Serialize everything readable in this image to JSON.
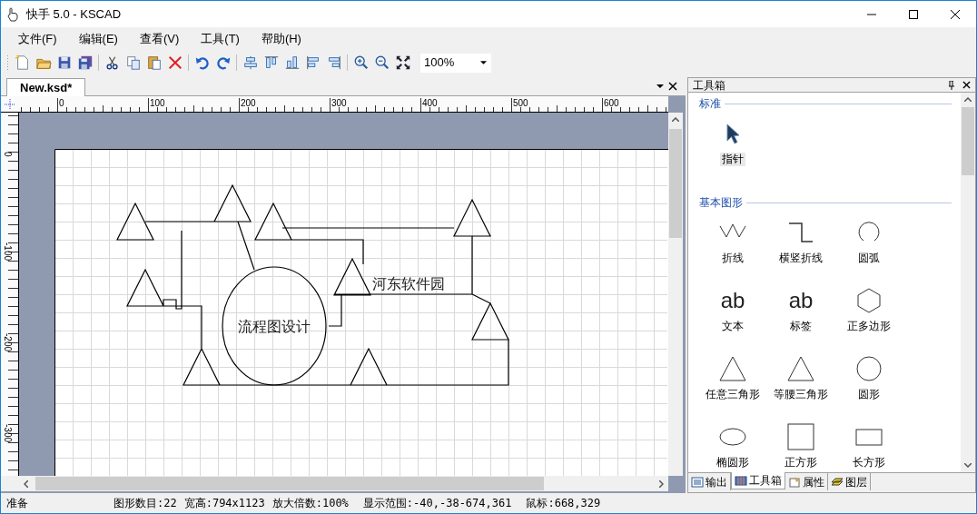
{
  "window": {
    "title": "快手 5.0 - KSCAD"
  },
  "menu": [
    "文件(F)",
    "编辑(E)",
    "查看(V)",
    "工具(T)",
    "帮助(H)"
  ],
  "toolbar": {
    "zoom_value": "100%"
  },
  "document_tabs": [
    {
      "label": "New.ksd*",
      "selected": true
    }
  ],
  "ruler": {
    "x_labels": [
      "0",
      "100",
      "200",
      "300",
      "400",
      "500",
      "600"
    ],
    "y_labels": [
      "0",
      "-100",
      "-200",
      "-300"
    ]
  },
  "canvas": {
    "labels": [
      "流程图设计",
      "河东软件园"
    ]
  },
  "toolbox": {
    "title": "工具箱",
    "sections": [
      {
        "title": "标准",
        "items": [
          {
            "kind": "pointer",
            "label": "指针",
            "selected": true
          }
        ]
      },
      {
        "title": "基本图形",
        "items": [
          {
            "kind": "polyline",
            "label": "折线",
            "selected": false
          },
          {
            "kind": "step",
            "label": "横竖折线",
            "selected": false
          },
          {
            "kind": "arc",
            "label": "圆弧",
            "selected": false
          },
          {
            "kind": "text",
            "glyph": "ab",
            "label": "文本",
            "selected": false
          },
          {
            "kind": "text",
            "glyph": "ab",
            "label": "标签",
            "selected": false
          },
          {
            "kind": "polygon",
            "label": "正多边形",
            "selected": false
          },
          {
            "kind": "triangle",
            "label": "任意三角形",
            "selected": false
          },
          {
            "kind": "triangle",
            "label": "等腰三角形",
            "selected": false
          },
          {
            "kind": "circle",
            "label": "圆形",
            "selected": false
          },
          {
            "kind": "ellipse",
            "label": "椭圆形",
            "selected": false
          },
          {
            "kind": "square",
            "label": "正方形",
            "selected": false
          },
          {
            "kind": "rectangle",
            "label": "长方形",
            "selected": false
          }
        ]
      }
    ]
  },
  "panel_tabs": [
    {
      "label": "输出",
      "selected": false
    },
    {
      "label": "工具箱",
      "selected": true
    },
    {
      "label": "属性",
      "selected": false
    },
    {
      "label": "图层",
      "selected": false
    }
  ],
  "status_bar": [
    "准备",
    "图形数目:22",
    "宽高:794x1123",
    "放大倍数:100%",
    "显示范围:-40,-38-674,361",
    "鼠标:668,329"
  ]
}
